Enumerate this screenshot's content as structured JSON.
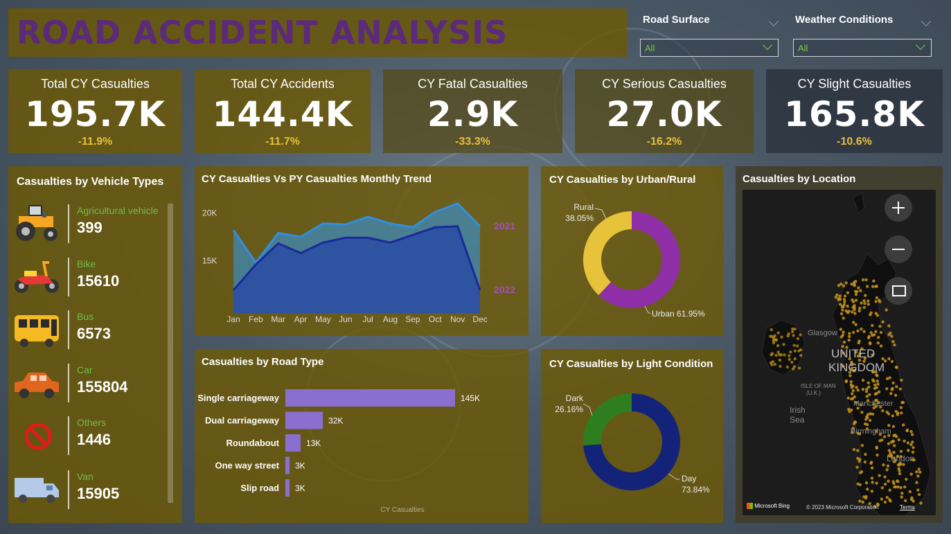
{
  "header": {
    "title": "ROAD ACCIDENT ANALYSIS"
  },
  "filters": [
    {
      "label": "Road Surface",
      "value": "All"
    },
    {
      "label": "Weather Conditions",
      "value": "All"
    }
  ],
  "kpis": [
    {
      "title": "Total CY Casualties",
      "value": "195.7K",
      "delta": "-11.9%"
    },
    {
      "title": "Total CY Accidents",
      "value": "144.4K",
      "delta": "-11.7%"
    },
    {
      "title": "CY Fatal Casualties",
      "value": "2.9K",
      "delta": "-33.3%"
    },
    {
      "title": "CY Serious Casualties",
      "value": "27.0K",
      "delta": "-16.2%"
    },
    {
      "title": "CY Slight Casualties",
      "value": "165.8K",
      "delta": "-10.6%"
    }
  ],
  "vehicles": {
    "title": "Casualties by Vehicle Types",
    "items": [
      {
        "name": "Agricultural vehicle",
        "value": "399",
        "icon": "tractor-icon"
      },
      {
        "name": "Bike",
        "value": "15610",
        "icon": "motorbike-icon"
      },
      {
        "name": "Bus",
        "value": "6573",
        "icon": "bus-icon"
      },
      {
        "name": "Car",
        "value": "155804",
        "icon": "car-icon"
      },
      {
        "name": "Others",
        "value": "1446",
        "icon": "no-entry-icon"
      },
      {
        "name": "Van",
        "value": "15905",
        "icon": "van-icon"
      }
    ]
  },
  "colors": {
    "kpi_delta": "#e6c13a",
    "vehicle_name": "#6cc04a",
    "bar": "#8b6fd0",
    "urban": "#8e2fa8",
    "rural": "#e6c33a",
    "day": "#14237a",
    "dark": "#2e7d1e",
    "cy_line": "#2f8fe0",
    "py_line": "#1a2a9a"
  },
  "chart_data": [
    {
      "type": "area",
      "title": "CY Casualties Vs PY Casualties Monthly Trend",
      "categories": [
        "Jan",
        "Feb",
        "Mar",
        "Apr",
        "May",
        "Jun",
        "Jul",
        "Aug",
        "Sep",
        "Oct",
        "Nov",
        "Dec"
      ],
      "yticks": [
        "15K",
        "20K"
      ],
      "ylim": [
        9500,
        22000
      ],
      "series": [
        {
          "name": "2021",
          "values": [
            18200,
            14800,
            17900,
            17500,
            18900,
            18800,
            19600,
            18900,
            18500,
            20100,
            21000,
            18600
          ]
        },
        {
          "name": "2022",
          "values": [
            11900,
            14600,
            16800,
            15800,
            16900,
            17400,
            17400,
            16900,
            17700,
            18500,
            18600,
            11900
          ]
        }
      ]
    },
    {
      "type": "pie",
      "title": "CY Casualties by Urban/Rural",
      "labels": [
        "Urban",
        "Rural"
      ],
      "values": [
        61.95,
        38.05
      ],
      "value_labels": [
        "61.95%",
        "38.05%"
      ]
    },
    {
      "type": "bar",
      "title": "Casualties by Road Type",
      "xlabel": "CY Casualties",
      "categories": [
        "Single carriageway",
        "Dual carriageway",
        "Roundabout",
        "One way street",
        "Slip road"
      ],
      "values": [
        145000,
        32000,
        13000,
        3000,
        3000
      ],
      "value_labels": [
        "145K",
        "32K",
        "13K",
        "3K",
        "3K"
      ]
    },
    {
      "type": "pie",
      "title": "CY Casualties by Light Condition",
      "labels": [
        "Day",
        "Dark"
      ],
      "values": [
        73.84,
        26.16
      ],
      "value_labels": [
        "73.84%",
        "26.16%"
      ]
    }
  ],
  "map": {
    "title": "Casualties by Location",
    "labels": {
      "country": "UNITED KINGDOM",
      "isle": "ISLE OF MAN (U.K.)",
      "sea": "Irish Sea",
      "city1": "Glasgow",
      "city2": "Manchester",
      "city3": "Birmingham",
      "city4": "London"
    },
    "attribution": "© 2023 Microsoft Corporation",
    "terms": "Terms",
    "logo": "Microsoft Bing"
  }
}
